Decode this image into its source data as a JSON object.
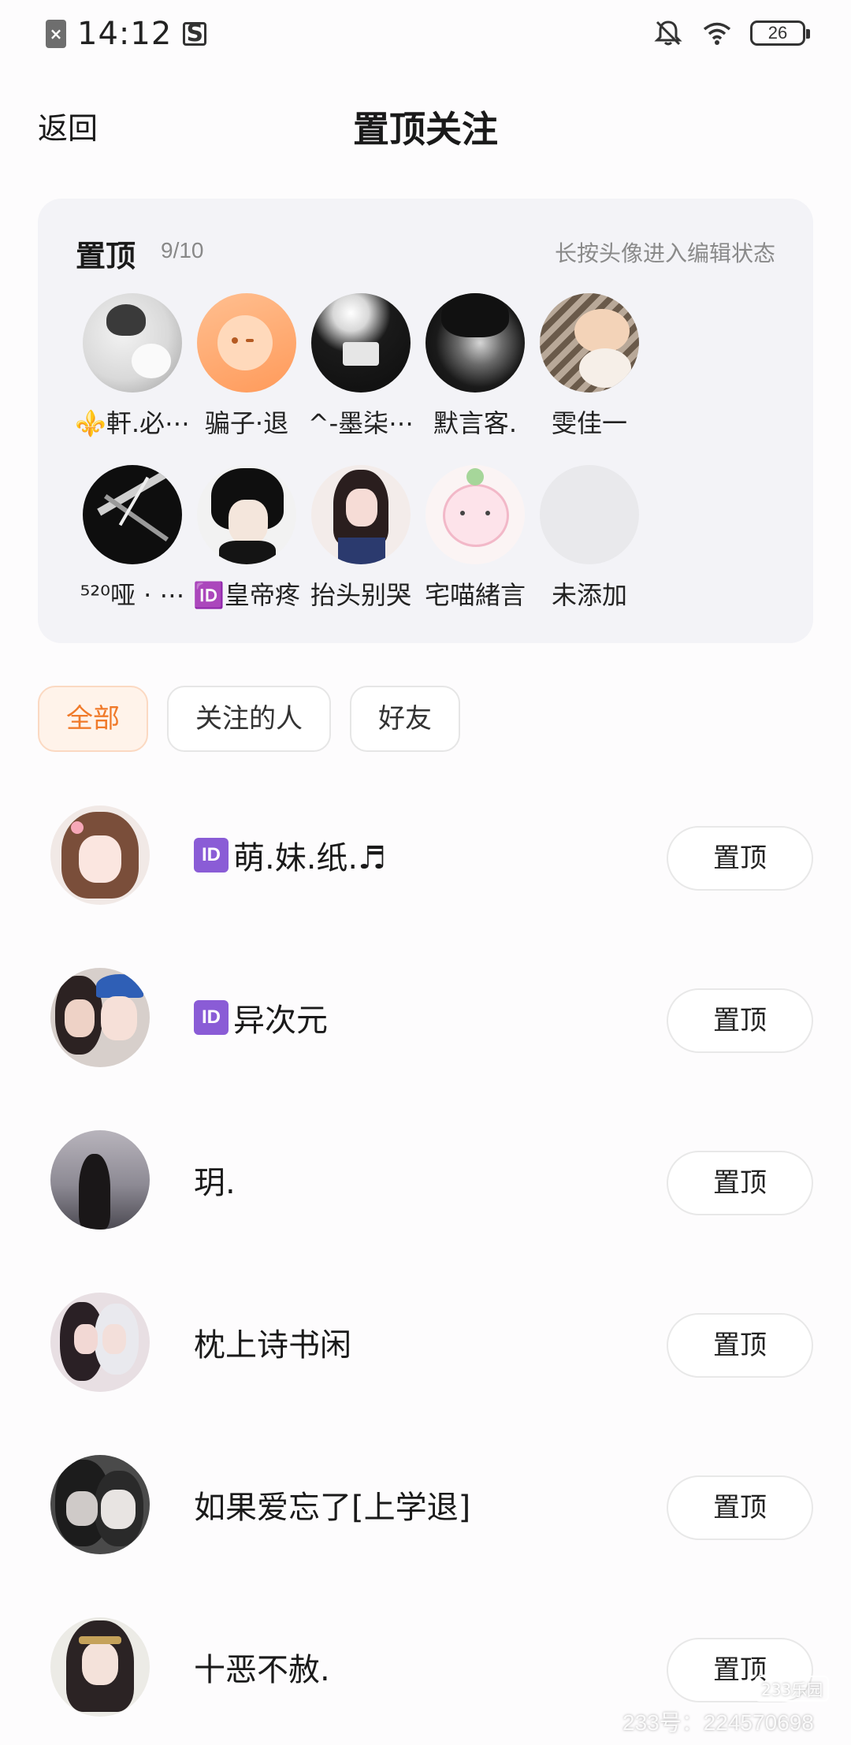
{
  "status_bar": {
    "time": "14:12",
    "battery": "26",
    "icons": [
      "sim-off-icon",
      "s-app-icon",
      "bell-muted-icon",
      "wifi-icon",
      "battery-icon"
    ]
  },
  "header": {
    "back_label": "返回",
    "title": "置顶关注"
  },
  "pinned": {
    "title": "置顶",
    "count": "9/10",
    "hint": "长按头像进入编辑状态",
    "items": [
      {
        "name": "⚜️軒.必⋯"
      },
      {
        "name": "骗子·退"
      },
      {
        "name": "^-墨柒⋯"
      },
      {
        "name": "默言客."
      },
      {
        "name": "雯佳一"
      },
      {
        "name": "⁵²⁰哑 · ⋯"
      },
      {
        "name": "🆔皇帝疼"
      },
      {
        "name": "抬头别哭"
      },
      {
        "name": "宅喵緒言"
      },
      {
        "name": "未添加"
      }
    ]
  },
  "filters": {
    "tabs": [
      {
        "label": "全部",
        "active": true
      },
      {
        "label": "关注的人",
        "active": false
      },
      {
        "label": "好友",
        "active": false
      }
    ]
  },
  "users": [
    {
      "badge": "ID",
      "name": "萌.妹.纸.♬",
      "button": "置顶"
    },
    {
      "badge": "ID",
      "name": "异次元",
      "button": "置顶"
    },
    {
      "badge": "",
      "name": "玥.",
      "button": "置顶"
    },
    {
      "badge": "",
      "name": "枕上诗书闲",
      "button": "置顶"
    },
    {
      "badge": "",
      "name": "如果爱忘了[上学退]",
      "button": "置顶"
    },
    {
      "badge": "",
      "name": "十恶不赦.",
      "button": "置顶"
    }
  ],
  "watermark": {
    "text": "233号：224570698",
    "logo": "233乐园"
  },
  "colors": {
    "accent": "#f07a2a",
    "card_bg": "#f3f3f7",
    "id_badge": "#8a5cd6"
  }
}
